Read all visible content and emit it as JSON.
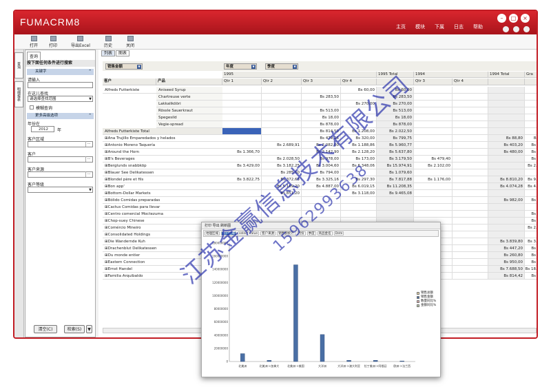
{
  "app": {
    "logo": "FUMACRM8"
  },
  "topnav": [
    "主页",
    "模块",
    "下属",
    "日志",
    "帮助"
  ],
  "toolbar": {
    "open": "打开",
    "print": "打印",
    "export": "导出Excel",
    "history": "历史",
    "close": "关闭"
  },
  "vtabs": [
    "查询",
    "明细报表"
  ],
  "left": {
    "tab": "查询",
    "title": "按下面任何条件进行搜索",
    "sect_keyword": "关键字",
    "keyword_label": "请输入",
    "search_in_label": "在这儿查找",
    "search_in_value": "请选择查找范围",
    "fuzzy_label": "模糊查询",
    "sect_more": "更多高级选项",
    "year_label": "年份在",
    "year_value": "2012",
    "year_unit": "年",
    "region_label": "客户区域",
    "customer_label": "客户",
    "source_label": "客户来源",
    "level_label": "客户等级",
    "clear_btn": "清空(C)",
    "search_btn": "检索(S)"
  },
  "main": {
    "tabs": [
      "列表",
      "图表"
    ],
    "field_product_area": "销售金额",
    "field_year": "年度",
    "field_quarter": "季度",
    "col_customer": "客户",
    "col_product": "产品",
    "year1": "1995",
    "year1_total": "1995 Total",
    "year2": "1994",
    "year2_total": "1994 Total",
    "grand": "Gra",
    "quarters": [
      "Qtr 1",
      "Qtr 2",
      "Qtr 3",
      "Qtr 4",
      "",
      "Qtr 3",
      "Qtr 4",
      "",
      ""
    ],
    "rows": [
      {
        "c": "Alfreds Futterkiste",
        "p": "Aniseed Syrup",
        "v": [
          "",
          "",
          "",
          "Bs 60,00",
          "Bs 60,00",
          "",
          "",
          "",
          ""
        ]
      },
      {
        "c": "",
        "p": "Chartreuse verte",
        "v": [
          "",
          "",
          "Bs 283,50",
          "",
          "Bs 283,50",
          "",
          "",
          "",
          ""
        ]
      },
      {
        "c": "",
        "p": "Lakkalikööri",
        "v": [
          "",
          "",
          "",
          "Bs 270,00",
          "Bs 270,00",
          "",
          "",
          "",
          ""
        ]
      },
      {
        "c": "",
        "p": "Rössle Sauerkraut",
        "v": [
          "",
          "",
          "Bs 513,00",
          "",
          "Bs 513,00",
          "",
          "",
          "",
          ""
        ]
      },
      {
        "c": "",
        "p": "Spegesild",
        "v": [
          "",
          "",
          "Bs 18,00",
          "",
          "Bs 18,00",
          "",
          "",
          "",
          ""
        ]
      },
      {
        "c": "",
        "p": "Vegie-spread",
        "v": [
          "",
          "",
          "Bs 878,00",
          "",
          "Bs 878,00",
          "",
          "",
          "",
          ""
        ]
      },
      {
        "c": "Alfreds Futterkiste Total",
        "p": "",
        "v": [
          "",
          "",
          "Bs 814,50",
          "Bs 1.208,00",
          "Bs 2.022,50",
          "",
          "",
          "",
          ""
        ]
      },
      {
        "c": "⊞Ana Trujillo Emparedados y helados",
        "p": "",
        "v": [
          "",
          "",
          "Bs 479,25",
          "Bs 320,00",
          "Bs 799,75",
          "",
          "",
          "Bs 88,80",
          "Bs 88,80"
        ]
      },
      {
        "c": "⊞Antonio Moreno Taquería",
        "p": "",
        "v": [
          "",
          "Bs 2.689,91",
          "Bs 2.082,00",
          "Bs 1.188,86",
          "Bs 5.960,77",
          "",
          "",
          "Bs 403,20",
          "Bs 403,20"
        ]
      },
      {
        "c": "⊞Around the Horn",
        "p": "",
        "v": [
          "Bs 1.366,70",
          "",
          "Bs 2.142,90",
          "Bs 2.128,20",
          "Bs 5.637,80",
          "",
          "",
          "Bs 480,00",
          "Bs 480,00"
        ]
      },
      {
        "c": "⊞B's Beverages",
        "p": "",
        "v": [
          "",
          "Bs 2.028,50",
          "Bs 978,00",
          "Bs 173,00",
          "Bs 3.179,50",
          "Bs 479,40",
          "",
          "",
          "Bs 479,40"
        ]
      },
      {
        "c": "⊞Berglunds snabbköp",
        "p": "",
        "v": [
          "Bs 3.429,00",
          "Bs 3.182,25",
          "Bs 3.004,60",
          "Bs 6.348,06",
          "Bs 15.974,91",
          "Bs 2.102,00",
          "",
          "",
          "Bs 2.102,00"
        ]
      },
      {
        "c": "⊞Blauer See Delikatessen",
        "p": "",
        "v": [
          "",
          "Bs 285,60",
          "Bs 794,00",
          "",
          "Bs 1.079,60",
          "",
          "",
          "",
          ""
        ]
      },
      {
        "c": "⊞Blondel père et fils",
        "p": "",
        "v": [
          "Bs 3.822,75",
          "Bs 372,65",
          "Bs 3.325,16",
          "Bs 297,30",
          "Bs 7.817,88",
          "Bs 1.176,00",
          "",
          "Bs 8.810,20",
          "Bs 9.986,20"
        ]
      },
      {
        "c": "⊞Bon app'",
        "p": "",
        "v": [
          "",
          "Bs 5.189,20",
          "Bs 4.887,00",
          "Bs 6.019,15",
          "Bs 11.208,35",
          "",
          "",
          "Bs 4.074,28",
          "Bs 4.074,28"
        ]
      },
      {
        "c": "⊞Bottom-Dollar Markets",
        "p": "",
        "v": [
          "",
          "Bs 851,20",
          "",
          "Bs 3.118,00",
          "Bs 9.465,08",
          "",
          "",
          "",
          ""
        ]
      },
      {
        "c": "⊞Bólido Comidas preparadas",
        "p": "",
        "v": [
          "",
          "",
          "",
          "",
          "",
          "",
          "",
          "Bs 982,00",
          "Bs 982,00"
        ]
      },
      {
        "c": "⊞Cactus Comidas para llevar",
        "p": "",
        "v": [
          "",
          "",
          "",
          "",
          "",
          "",
          "",
          "",
          ""
        ]
      },
      {
        "c": "⊞Centro comercial Moctezuma",
        "p": "",
        "v": [
          "",
          "",
          "",
          "",
          "",
          "",
          "",
          "",
          "Bs 100,80"
        ]
      },
      {
        "c": "⊞Chop-suey Chinese",
        "p": "",
        "v": [
          "",
          "",
          "",
          "",
          "",
          "",
          "",
          "",
          "Bs 556,62"
        ]
      },
      {
        "c": "⊞Comércio Mineiro",
        "p": "",
        "v": [
          "",
          "",
          "",
          "",
          "",
          "",
          "",
          "",
          "Bs 2.169,00"
        ]
      },
      {
        "c": "⊞Consolidated Holdings",
        "p": "",
        "v": [
          "",
          "",
          "",
          "",
          "",
          "",
          "",
          "",
          ""
        ]
      },
      {
        "c": "⊞Die Wandernde Kuh",
        "p": "",
        "v": [
          "",
          "",
          "",
          "",
          "",
          "",
          "",
          "Bs 3.839,80",
          "Bs 3.839,80"
        ]
      },
      {
        "c": "⊞Drachenblut Delikatessen",
        "p": "",
        "v": [
          "",
          "",
          "",
          "",
          "",
          "",
          "",
          "Bs 447,20",
          "Bs 447,20"
        ]
      },
      {
        "c": "⊞Du monde entier",
        "p": "",
        "v": [
          "",
          "",
          "",
          "",
          "",
          "",
          "",
          "Bs 260,80",
          "Bs 260,80"
        ]
      },
      {
        "c": "⊞Eastern Connection",
        "p": "",
        "v": [
          "",
          "",
          "",
          "",
          "",
          "",
          "",
          "Bs 950,00",
          "Bs 950,00"
        ]
      },
      {
        "c": "⊞Ernst Handel",
        "p": "",
        "v": [
          "",
          "",
          "",
          "",
          "",
          "",
          "",
          "Bs 7.688,50",
          "Bs 18.577,18"
        ]
      },
      {
        "c": "⊞Familia Arquibaldo",
        "p": "",
        "v": [
          "",
          "",
          "",
          "",
          "",
          "",
          "",
          "Bs 814,42",
          "Bs 814,42"
        ]
      }
    ]
  },
  "popup": {
    "toolbar": "打印  导出  刷新图",
    "tabs": [
      "地理区域",
      "客户区域",
      "select value",
      "客户来源",
      "销售额统计",
      "月份",
      "季度",
      "商品金名",
      "Date"
    ],
    "legend": [
      "销售总额",
      "销售金额",
      "数量同比%",
      "金额同比%"
    ]
  },
  "chart_data": {
    "type": "bar",
    "categories": [
      "北美洲",
      "北美洲->加拿大",
      "北美洲->美国",
      "大洋洲",
      "大洋洲->澳大利亚",
      "拉丁美洲->阿根廷",
      "欧洲->法兰西"
    ],
    "values": [
      12000000,
      1800000,
      147000000,
      41000000,
      1800000,
      1900000,
      900000
    ],
    "ylim": [
      0,
      180000000
    ],
    "yticks": [
      0,
      20000000,
      40000000,
      60000000,
      80000000,
      100000000,
      120000000,
      140000000,
      160000000,
      180000000
    ],
    "bar_color": "#4a6fa5"
  },
  "watermark_line1": "江苏金赢信息技术有限公司",
  "watermark_line2": "15962993638"
}
